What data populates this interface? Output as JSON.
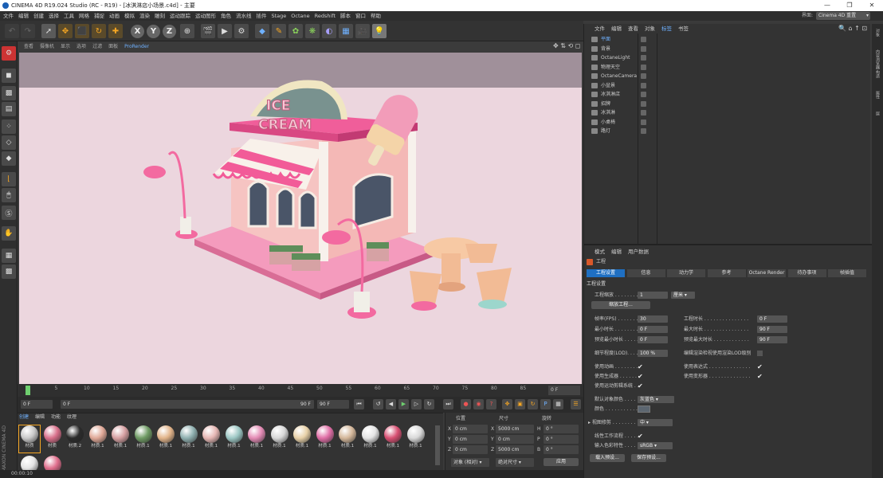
{
  "window": {
    "title": "CINEMA 4D R19.024 Studio (RC - R19) - [冰淇淋店小场景.c4d] - 主要"
  },
  "menubar": {
    "items": [
      "文件",
      "编辑",
      "创建",
      "选择",
      "工具",
      "网格",
      "捕捉",
      "动画",
      "模拟",
      "渲染",
      "雕刻",
      "运动跟踪",
      "运动图形",
      "角色",
      "流水线",
      "插件",
      "Stage",
      "Octane",
      "Redshift",
      "脚本",
      "窗口",
      "帮助"
    ],
    "layout_label": "界面:",
    "layout_value": "Cinema 4D 重置"
  },
  "viewport": {
    "menu": [
      "查看",
      "摄像机",
      "显示",
      "选项",
      "过滤",
      "面板"
    ],
    "prorender": "ProRender",
    "sign_line1": "ICE",
    "sign_line2": "CREAM"
  },
  "timeline": {
    "ticks": [
      "0",
      "5",
      "10",
      "15",
      "20",
      "25",
      "30",
      "35",
      "40",
      "45",
      "50",
      "55",
      "60",
      "65",
      "70",
      "75",
      "80",
      "85",
      "90"
    ],
    "frame_display": "0 F",
    "start": "0 F",
    "current": "0 F",
    "end_a": "90 F",
    "end_b": "90 F"
  },
  "materials": {
    "tabs": [
      "创建",
      "编辑",
      "功能",
      "纹理"
    ],
    "items": [
      {
        "label": "材质",
        "color": "#c9c9c9"
      },
      {
        "label": "材质",
        "color": "#d86f8a"
      },
      {
        "label": "材质.2",
        "color": "#2b2b2b"
      },
      {
        "label": "材质.1",
        "color": "#e0a897"
      },
      {
        "label": "材质.1",
        "color": "#d6a0a2"
      },
      {
        "label": "材质.1",
        "color": "#6f9b64"
      },
      {
        "label": "材质.1",
        "color": "#e2b48a"
      },
      {
        "label": "材质.1",
        "color": "#8fb0b0"
      },
      {
        "label": "材质.1",
        "color": "#e6b7b4"
      },
      {
        "label": "材质.1",
        "color": "#9cc7c4"
      },
      {
        "label": "材质.1",
        "color": "#e48bb5"
      },
      {
        "label": "材质.1",
        "color": "#d8d8d8"
      },
      {
        "label": "材质.1",
        "color": "#e8d1a8"
      },
      {
        "label": "材质.1",
        "color": "#e06ea6"
      },
      {
        "label": "材质.1",
        "color": "#d4b79a"
      },
      {
        "label": "材质.1",
        "color": "#e4e4e4"
      },
      {
        "label": "材质.1",
        "color": "#d84f72"
      },
      {
        "label": "材质.1",
        "color": "#d9d9d9"
      }
    ],
    "row2": [
      {
        "color": "#e4e4e4"
      },
      {
        "color": "#e06e8c"
      }
    ]
  },
  "coords": {
    "headers": [
      "位置",
      "尺寸",
      "旋转"
    ],
    "rows": [
      {
        "axis": "X",
        "pos": "0 cm",
        "size_axis": "X",
        "size": "5000 cm",
        "rot_axis": "H",
        "rot": "0 °"
      },
      {
        "axis": "Y",
        "pos": "0 cm",
        "size_axis": "Y",
        "size": "0 cm",
        "rot_axis": "P",
        "rot": "0 °"
      },
      {
        "axis": "Z",
        "pos": "0 cm",
        "size_axis": "Z",
        "size": "5000 cm",
        "rot_axis": "B",
        "rot": "0 °"
      }
    ],
    "mode": "对象 (相对)",
    "size_mode": "绝对尺寸",
    "apply": "应用"
  },
  "object_manager": {
    "menu": [
      "文件",
      "编辑",
      "查看",
      "对象",
      "标签",
      "书签"
    ],
    "selected_menu": "标签",
    "objects": [
      {
        "name": "平面",
        "selected": true
      },
      {
        "name": "背景",
        "selected": false
      },
      {
        "name": "OctaneLight",
        "selected": false
      },
      {
        "name": "物理天空",
        "selected": false
      },
      {
        "name": "OctaneCamera",
        "selected": false
      },
      {
        "name": "小盆景",
        "selected": false
      },
      {
        "name": "冰淇淋店",
        "selected": false
      },
      {
        "name": "招牌",
        "selected": false
      },
      {
        "name": "冰淇淋",
        "selected": false
      },
      {
        "name": "小桌椅",
        "selected": false
      },
      {
        "name": "路灯",
        "selected": false
      }
    ]
  },
  "attributes": {
    "menu": [
      "模式",
      "编辑",
      "用户数据"
    ],
    "object_title": "工程",
    "tabs": [
      "工程设置",
      "信息",
      "动力学",
      "参考",
      "Octane Render",
      "待办事项",
      "帧插值"
    ],
    "section": "工程设置",
    "scale_label": "工程缩放 . . . . . . . .",
    "scale_value": "1",
    "scale_unit": "厘米",
    "scale_btn": "缩放工程...",
    "fps_label": "帧率(FPS) . . . . . . .",
    "fps_value": "30",
    "min_label": "最小时长 . . . . . . . .",
    "min_value": "0 F",
    "premin_label": "预览最小时长 . . . . .",
    "premin_value": "0 F",
    "time_label": "工程时长 . . . . . . . . . . . . . . .",
    "time_value": "0 F",
    "max_label": "最大时长 . . . . . . . . . . . . . . .",
    "max_value": "90 F",
    "premax_label": "预览最大时长 . . . . . . . . . . . .",
    "premax_value": "90 F",
    "lod_label": "细节程度(LOD). . . .",
    "lod_value": "100 %",
    "lod_check": "编辑渲染检视使用渲染LOD级别",
    "anim_label": "使用动画 . . . . . . . .",
    "gen_label": "使用生成器 . . . . . . .",
    "mo_label": "使用运动剪辑系统 . .",
    "expr_label": "使用表达式 . . . . . . . . . . . . . .",
    "deform_label": "使用变形器 . . . . . . . . . . . . . .",
    "objcolor_label": "默认对象颜色 . . . .",
    "objcolor_value": "灰蓝色",
    "color_label": "颜色 . . . . . . . . . . .",
    "clip_label": "视图修剪 . . . . . . . .",
    "clip_value": "中",
    "linear_label": "线性工作流程 . . . . .",
    "inputcolor_label": "输入色彩特性 . . . .",
    "inputcolor_value": "sRGB",
    "load_btn": "载入预设...",
    "save_btn": "保存预设..."
  },
  "status": {
    "time": "00:00:10"
  },
  "right_strip": [
    "对象",
    "内容浏览器",
    "构造",
    "属性",
    "层"
  ]
}
